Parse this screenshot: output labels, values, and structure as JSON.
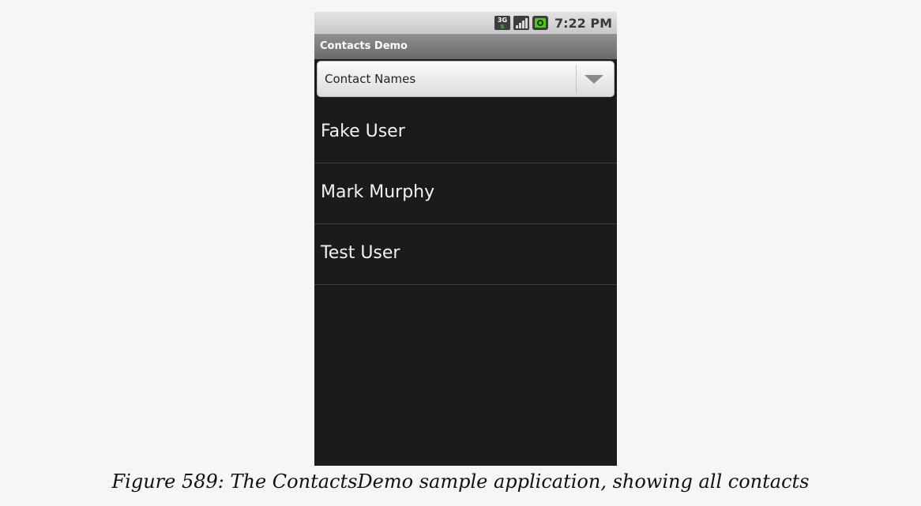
{
  "status_bar": {
    "time": "7:22 PM",
    "network_icon": "3g-data-icon",
    "signal_icon": "signal-strength-icon",
    "battery_icon": "battery-charging-icon"
  },
  "app": {
    "title": "Contacts Demo"
  },
  "spinner": {
    "selected": "Contact Names",
    "arrow_icon": "dropdown-arrow-icon"
  },
  "contacts": [
    {
      "name": "Fake User"
    },
    {
      "name": "Mark Murphy"
    },
    {
      "name": "Test User"
    }
  ],
  "caption": "Figure 589: The ContactsDemo sample application, showing all contacts",
  "colors": {
    "background": "#1b1b1b",
    "title_bar": "#7a7a7a",
    "battery_fill": "#55c61f"
  }
}
